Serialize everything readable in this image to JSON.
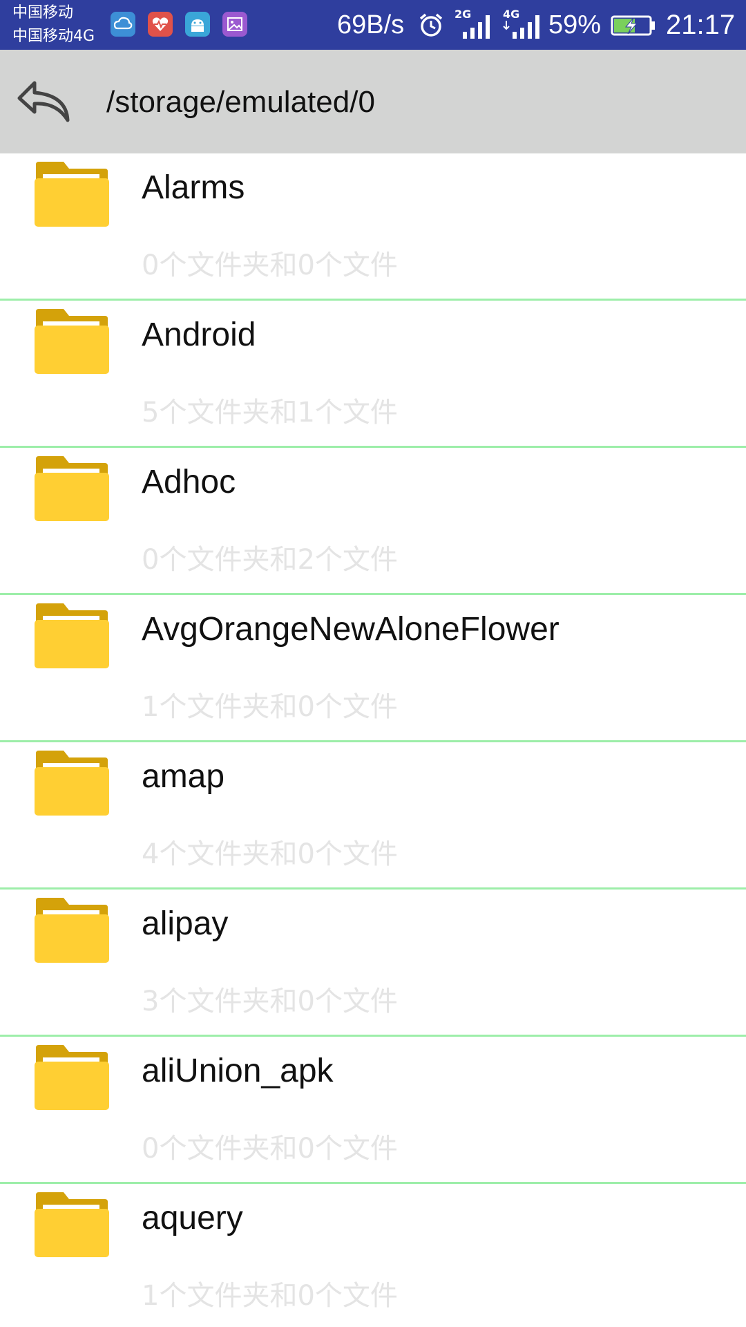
{
  "status_bar": {
    "carrier_1": "中国移动",
    "carrier_2": "中国移动4G",
    "net_speed": "69B/s",
    "battery_percent": "59%",
    "time": "21:17",
    "signal_1_label": "2G",
    "signal_2_label": "4G",
    "notification_icons": [
      "cloud-icon",
      "health-icon",
      "android-icon",
      "gallery-icon"
    ]
  },
  "header": {
    "back_icon": "back-arrow-icon",
    "path": "/storage/emulated/0"
  },
  "colors": {
    "status_bar_bg": "#2f3e9e",
    "header_bg": "#d3d4d3",
    "folder_front": "#ffcf33",
    "folder_back": "#d4a20a",
    "divider": "#9deea9",
    "meta_text": "#e4e4e4"
  },
  "files": [
    {
      "name": "Alarms",
      "meta": "0个文件夹和0个文件",
      "icon": "folder-icon"
    },
    {
      "name": "Android",
      "meta": "5个文件夹和1个文件",
      "icon": "folder-icon"
    },
    {
      "name": "Adhoc",
      "meta": "0个文件夹和2个文件",
      "icon": "folder-icon"
    },
    {
      "name": "AvgOrangeNewAloneFlower",
      "meta": "1个文件夹和0个文件",
      "icon": "folder-icon"
    },
    {
      "name": "amap",
      "meta": "4个文件夹和0个文件",
      "icon": "folder-icon"
    },
    {
      "name": "alipay",
      "meta": "3个文件夹和0个文件",
      "icon": "folder-icon"
    },
    {
      "name": "aliUnion_apk",
      "meta": "0个文件夹和0个文件",
      "icon": "folder-icon"
    },
    {
      "name": "aquery",
      "meta": "1个文件夹和0个文件",
      "icon": "folder-icon"
    }
  ]
}
